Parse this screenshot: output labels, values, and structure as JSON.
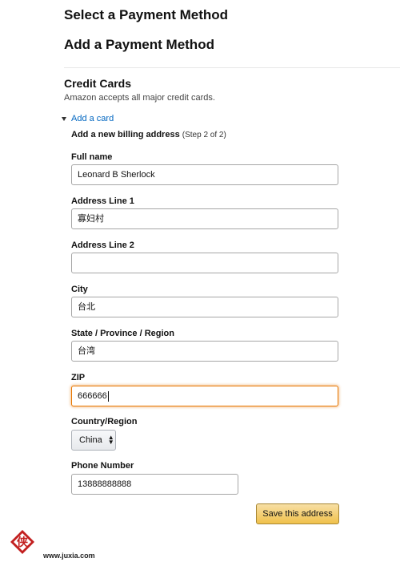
{
  "header": {
    "title": "Select a Payment Method",
    "subtitle": "Add a Payment Method"
  },
  "credit_cards": {
    "title": "Credit Cards",
    "description": "Amazon accepts all major credit cards.",
    "add_card_link": "Add a card"
  },
  "billing": {
    "title": "Add a new billing address",
    "step": "(Step 2 of 2)"
  },
  "form": {
    "full_name": {
      "label": "Full name",
      "value": "Leonard B Sherlock"
    },
    "address1": {
      "label": "Address Line 1",
      "value": "寡妇村"
    },
    "address2": {
      "label": "Address Line 2",
      "value": ""
    },
    "city": {
      "label": "City",
      "value": "台北"
    },
    "state": {
      "label": "State / Province / Region",
      "value": "台湾"
    },
    "zip": {
      "label": "ZIP",
      "value": "666666"
    },
    "country": {
      "label": "Country/Region",
      "value": "China"
    },
    "phone": {
      "label": "Phone Number",
      "value": "13888888888"
    }
  },
  "save_button": "Save this address",
  "watermark": {
    "logo_char": "侠",
    "text": "www.juxia.com",
    "icon": "chevron-icon"
  },
  "colors": {
    "link": "#0066c0",
    "focus_border": "#e77600",
    "button_bg": "#f0c14b"
  }
}
